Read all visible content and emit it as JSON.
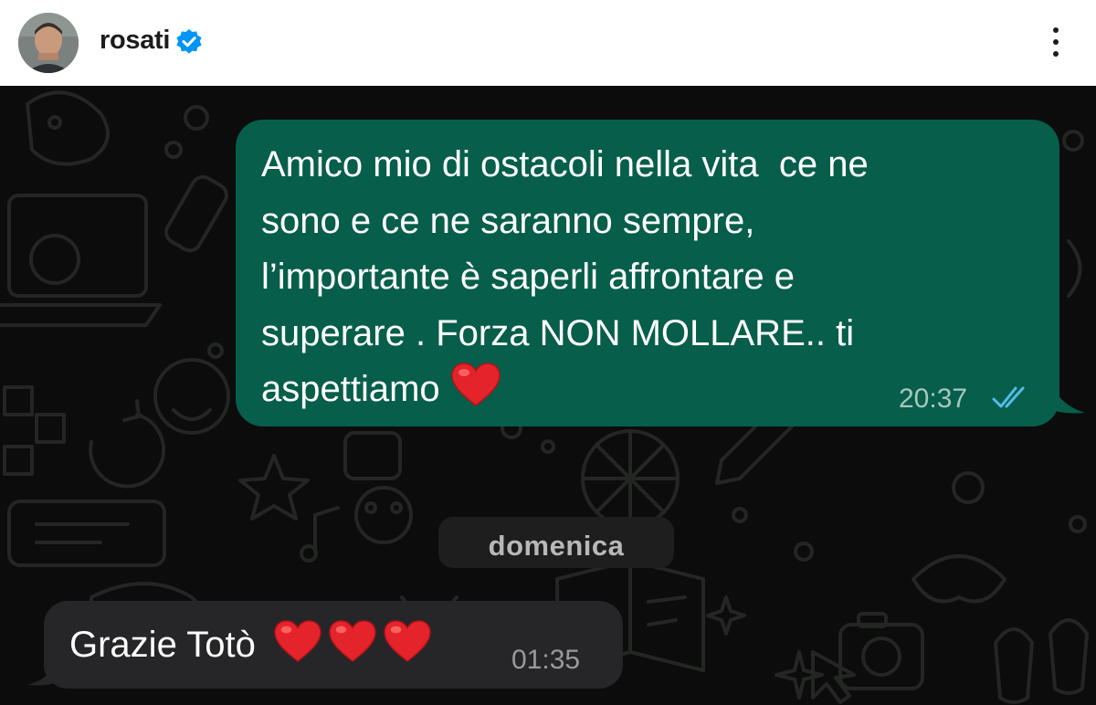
{
  "header": {
    "username": "rosati",
    "verified_icon": "verified-badge-icon",
    "more_icon": "more-vertical-icon"
  },
  "chat": {
    "outgoing": {
      "text": "Amico mio di ostacoli nella vita  ce ne\nsono e ce ne saranno sempre,\nl’importante è saperli affrontare e\nsuperare . Forza NON MOLLARE.. ti\naspettiamo",
      "emoji": "red-heart-icon",
      "time": "20:37",
      "status_icon": "double-check-read-icon"
    },
    "date_separator": "domenica",
    "incoming": {
      "text": "Grazie Totò",
      "emoji_count": 3,
      "emoji": "red-heart-icon",
      "time": "01:35"
    }
  },
  "colors": {
    "chat_background": "#0b0c0b",
    "outgoing_bubble": "#075e4a",
    "incoming_bubble": "#262628",
    "read_ticks": "#53bdeb",
    "verified_badge": "#0095f6"
  }
}
